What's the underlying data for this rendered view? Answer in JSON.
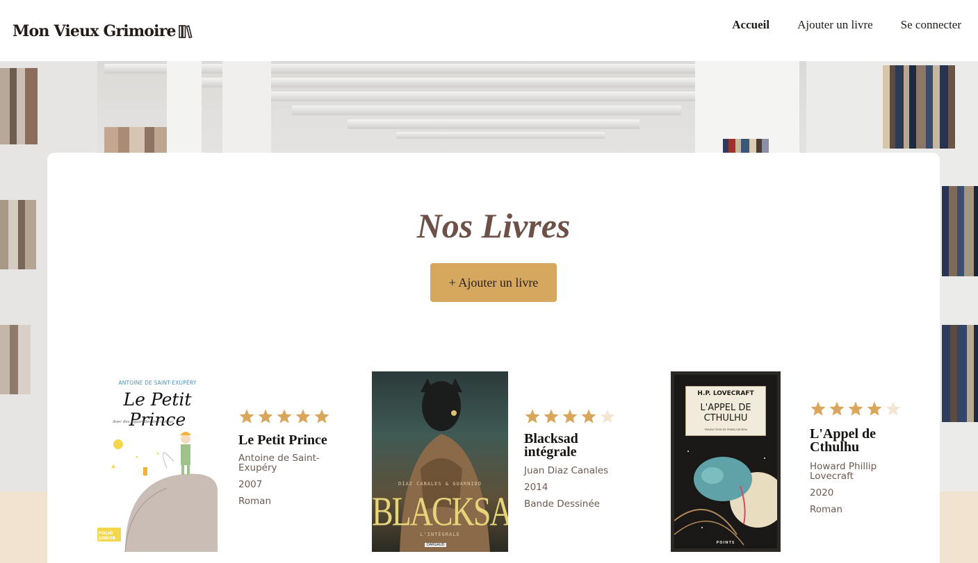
{
  "header": {
    "logo_text": "Mon Vieux Grimoire",
    "nav": [
      {
        "label": "Accueil",
        "active": true
      },
      {
        "label": "Ajouter un livre",
        "active": false
      },
      {
        "label": "Se connecter",
        "active": false
      }
    ]
  },
  "main": {
    "title": "Nos Livres",
    "add_button_label": "+ Ajouter un livre"
  },
  "books": [
    {
      "title": "Le Petit Prince",
      "author": "Antoine de Saint-Exupéry",
      "year": "2007",
      "genre": "Roman",
      "rating": 5,
      "cover": {
        "author": "ANTOINE DE SAINT-EXUPÉRY",
        "title": "Le Petit Prince",
        "subtitle": "Avec des aquarelles de l'auteur",
        "badge": "FOLIO JUNIOR"
      }
    },
    {
      "title": "Blacksad intégrale",
      "author": "Juan Diaz Canales",
      "year": "2014",
      "genre": "Bande Dessinée",
      "rating": 4,
      "cover": {
        "authors": "DÍAZ CANALES & GUARNIDO",
        "title": "BLACKSAD",
        "subtitle": "L'INTÉGRALE",
        "publisher": "DARGAUD"
      }
    },
    {
      "title": "L'Appel de Cthulhu",
      "author": "Howard Phillip Lovecraft",
      "year": "2020",
      "genre": "Roman",
      "rating": 4,
      "cover": {
        "author": "H.P. LOVECRAFT",
        "title": "L'APPEL DE CTHULHU",
        "subtitle": "TRADUCTION DE FRANÇOIS BON",
        "publisher": "POINTS"
      }
    }
  ],
  "colors": {
    "accent": "#d6a75f",
    "star_filled": "#d9a75c",
    "star_empty": "#f3e6d3",
    "title": "#6d5148",
    "cream_band": "#f2e3d1"
  }
}
